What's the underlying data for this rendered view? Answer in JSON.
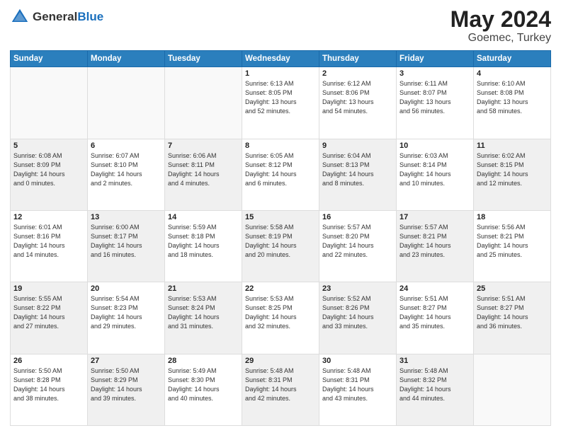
{
  "header": {
    "logo_general": "General",
    "logo_blue": "Blue",
    "title": "May 2024",
    "location": "Goemec, Turkey"
  },
  "days_of_week": [
    "Sunday",
    "Monday",
    "Tuesday",
    "Wednesday",
    "Thursday",
    "Friday",
    "Saturday"
  ],
  "weeks": [
    [
      {
        "day": "",
        "info": "",
        "empty": true
      },
      {
        "day": "",
        "info": "",
        "empty": true
      },
      {
        "day": "",
        "info": "",
        "empty": true
      },
      {
        "day": "1",
        "info": "Sunrise: 6:13 AM\nSunset: 8:05 PM\nDaylight: 13 hours\nand 52 minutes."
      },
      {
        "day": "2",
        "info": "Sunrise: 6:12 AM\nSunset: 8:06 PM\nDaylight: 13 hours\nand 54 minutes."
      },
      {
        "day": "3",
        "info": "Sunrise: 6:11 AM\nSunset: 8:07 PM\nDaylight: 13 hours\nand 56 minutes."
      },
      {
        "day": "4",
        "info": "Sunrise: 6:10 AM\nSunset: 8:08 PM\nDaylight: 13 hours\nand 58 minutes."
      }
    ],
    [
      {
        "day": "5",
        "info": "Sunrise: 6:08 AM\nSunset: 8:09 PM\nDaylight: 14 hours\nand 0 minutes.",
        "shaded": true
      },
      {
        "day": "6",
        "info": "Sunrise: 6:07 AM\nSunset: 8:10 PM\nDaylight: 14 hours\nand 2 minutes."
      },
      {
        "day": "7",
        "info": "Sunrise: 6:06 AM\nSunset: 8:11 PM\nDaylight: 14 hours\nand 4 minutes.",
        "shaded": true
      },
      {
        "day": "8",
        "info": "Sunrise: 6:05 AM\nSunset: 8:12 PM\nDaylight: 14 hours\nand 6 minutes."
      },
      {
        "day": "9",
        "info": "Sunrise: 6:04 AM\nSunset: 8:13 PM\nDaylight: 14 hours\nand 8 minutes.",
        "shaded": true
      },
      {
        "day": "10",
        "info": "Sunrise: 6:03 AM\nSunset: 8:14 PM\nDaylight: 14 hours\nand 10 minutes."
      },
      {
        "day": "11",
        "info": "Sunrise: 6:02 AM\nSunset: 8:15 PM\nDaylight: 14 hours\nand 12 minutes.",
        "shaded": true
      }
    ],
    [
      {
        "day": "12",
        "info": "Sunrise: 6:01 AM\nSunset: 8:16 PM\nDaylight: 14 hours\nand 14 minutes."
      },
      {
        "day": "13",
        "info": "Sunrise: 6:00 AM\nSunset: 8:17 PM\nDaylight: 14 hours\nand 16 minutes.",
        "shaded": true
      },
      {
        "day": "14",
        "info": "Sunrise: 5:59 AM\nSunset: 8:18 PM\nDaylight: 14 hours\nand 18 minutes."
      },
      {
        "day": "15",
        "info": "Sunrise: 5:58 AM\nSunset: 8:19 PM\nDaylight: 14 hours\nand 20 minutes.",
        "shaded": true
      },
      {
        "day": "16",
        "info": "Sunrise: 5:57 AM\nSunset: 8:20 PM\nDaylight: 14 hours\nand 22 minutes."
      },
      {
        "day": "17",
        "info": "Sunrise: 5:57 AM\nSunset: 8:21 PM\nDaylight: 14 hours\nand 23 minutes.",
        "shaded": true
      },
      {
        "day": "18",
        "info": "Sunrise: 5:56 AM\nSunset: 8:21 PM\nDaylight: 14 hours\nand 25 minutes."
      }
    ],
    [
      {
        "day": "19",
        "info": "Sunrise: 5:55 AM\nSunset: 8:22 PM\nDaylight: 14 hours\nand 27 minutes.",
        "shaded": true
      },
      {
        "day": "20",
        "info": "Sunrise: 5:54 AM\nSunset: 8:23 PM\nDaylight: 14 hours\nand 29 minutes."
      },
      {
        "day": "21",
        "info": "Sunrise: 5:53 AM\nSunset: 8:24 PM\nDaylight: 14 hours\nand 31 minutes.",
        "shaded": true
      },
      {
        "day": "22",
        "info": "Sunrise: 5:53 AM\nSunset: 8:25 PM\nDaylight: 14 hours\nand 32 minutes."
      },
      {
        "day": "23",
        "info": "Sunrise: 5:52 AM\nSunset: 8:26 PM\nDaylight: 14 hours\nand 33 minutes.",
        "shaded": true
      },
      {
        "day": "24",
        "info": "Sunrise: 5:51 AM\nSunset: 8:27 PM\nDaylight: 14 hours\nand 35 minutes."
      },
      {
        "day": "25",
        "info": "Sunrise: 5:51 AM\nSunset: 8:27 PM\nDaylight: 14 hours\nand 36 minutes.",
        "shaded": true
      }
    ],
    [
      {
        "day": "26",
        "info": "Sunrise: 5:50 AM\nSunset: 8:28 PM\nDaylight: 14 hours\nand 38 minutes."
      },
      {
        "day": "27",
        "info": "Sunrise: 5:50 AM\nSunset: 8:29 PM\nDaylight: 14 hours\nand 39 minutes.",
        "shaded": true
      },
      {
        "day": "28",
        "info": "Sunrise: 5:49 AM\nSunset: 8:30 PM\nDaylight: 14 hours\nand 40 minutes."
      },
      {
        "day": "29",
        "info": "Sunrise: 5:48 AM\nSunset: 8:31 PM\nDaylight: 14 hours\nand 42 minutes.",
        "shaded": true
      },
      {
        "day": "30",
        "info": "Sunrise: 5:48 AM\nSunset: 8:31 PM\nDaylight: 14 hours\nand 43 minutes."
      },
      {
        "day": "31",
        "info": "Sunrise: 5:48 AM\nSunset: 8:32 PM\nDaylight: 14 hours\nand 44 minutes.",
        "shaded": true
      },
      {
        "day": "",
        "info": "",
        "empty": true
      }
    ]
  ]
}
